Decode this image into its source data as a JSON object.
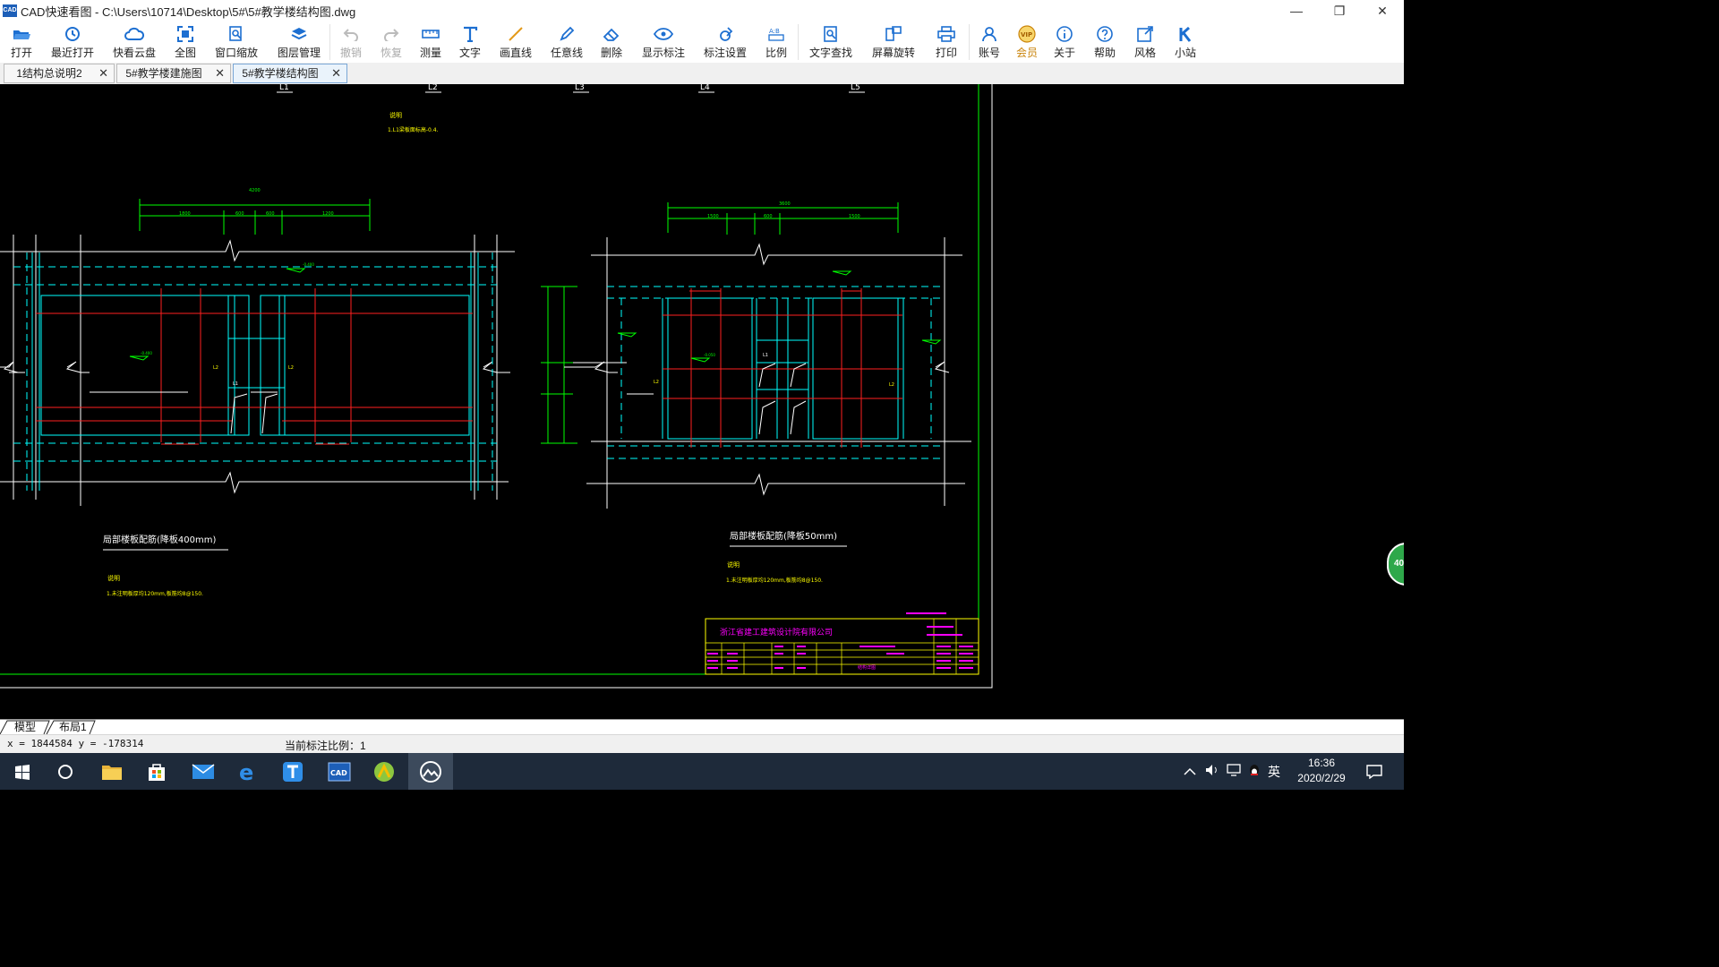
{
  "window": {
    "title": "CAD快速看图 - C:\\Users\\10714\\Desktop\\5#\\5#教学楼结构图.dwg",
    "minimize": "—",
    "restore": "❐",
    "close": "✕",
    "logo_text": "CAD"
  },
  "toolbar": {
    "open": "打开",
    "recent": "最近打开",
    "cloud": "快看云盘",
    "fit_all": "全图",
    "window_zoom": "窗口缩放",
    "layers": "图层管理",
    "undo": "撤销",
    "redo": "恢复",
    "measure": "测量",
    "text": "文字",
    "line": "画直线",
    "freehand": "任意线",
    "erase": "删除",
    "show_dims": "显示标注",
    "dim_settings": "标注设置",
    "ratio": "比例",
    "text_search": "文字查找",
    "rotate": "屏幕旋转",
    "print": "打印",
    "account": "账号",
    "vip": "会员",
    "about": "关于",
    "help": "帮助",
    "style": "风格",
    "site": "小站"
  },
  "tabs": [
    {
      "label": "1结构总说明2",
      "close": "✕"
    },
    {
      "label": "5#教学楼建施图",
      "close": "✕"
    },
    {
      "label": "5#教学楼结构图",
      "close": "✕"
    }
  ],
  "drawing": {
    "grid_labels": [
      "L1",
      "L2",
      "L3",
      "L4",
      "L5"
    ],
    "left_detail_title": "局部楼板配筋(降板400mm)",
    "right_detail_title": "局部楼板配筋(降板50mm)",
    "note_heading": "说明",
    "note_top": "1.L1梁板面标高-0.4.",
    "note_left": "1.未注明板厚均120mm,板筋均8@150.",
    "note_right": "1.未注明板厚均120mm,板筋均8@150.",
    "title_block_company": "浙江省建工建筑设计院有限公司",
    "title_block_drawing": "结构详图",
    "dim_left_total": "4200",
    "dim_left_parts": [
      "1800",
      "600",
      "600",
      "1200"
    ],
    "dim_right_total": "3600",
    "dim_right_parts": [
      "1500",
      "600",
      "1500"
    ],
    "beam_labels": [
      "L1",
      "L2",
      "L1",
      "L2"
    ],
    "level_marks": [
      "-0.400",
      "-0.050"
    ],
    "badge": "40"
  },
  "layout_tabs": {
    "model": "模型",
    "layout1": "布局1"
  },
  "status": {
    "coords": "x = 1844584  y = -178314",
    "scale": "当前标注比例：1"
  },
  "tray": {
    "ime": "英",
    "time": "16:36",
    "date": "2020/2/29"
  },
  "colors": {
    "accent": "#1d6fd1",
    "cad_cyan": "#00ffff",
    "cad_red": "#ff2020",
    "cad_green": "#00ff00",
    "cad_yellow": "#ffff00",
    "cad_magenta": "#ff00ff"
  }
}
